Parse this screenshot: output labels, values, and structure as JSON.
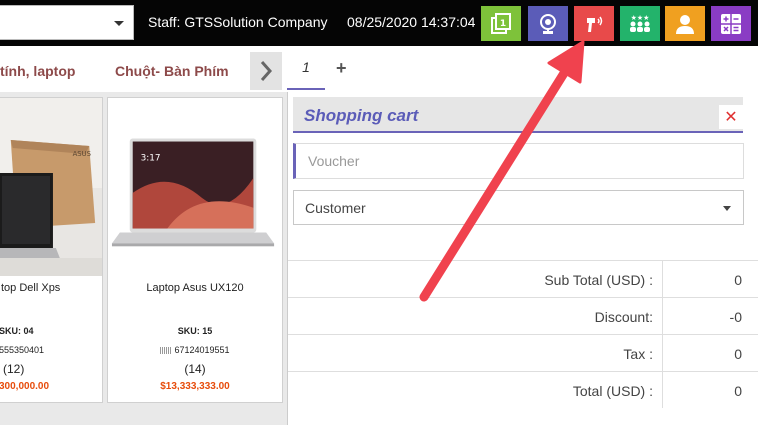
{
  "topbar": {
    "staff": "Staff: GTSSolution Company",
    "datetime": "08/25/2020 14:37:04",
    "buttons": [
      {
        "icon": "display-icon",
        "color": "#7ec23a"
      },
      {
        "icon": "webcam-icon",
        "color": "#5b5cb8"
      },
      {
        "icon": "barcode-scanner-icon",
        "color": "#e84a4a"
      },
      {
        "icon": "rating-users-icon",
        "color": "#23b36b"
      },
      {
        "icon": "user-icon",
        "color": "#f0a020"
      },
      {
        "icon": "calculator-icon",
        "color": "#8a3cc4"
      }
    ]
  },
  "categories": [
    {
      "label": "tính, laptop"
    },
    {
      "label": "Chuột- Bàn Phím"
    }
  ],
  "orders": {
    "tabs": [
      {
        "label": "1"
      }
    ],
    "add_label": "+"
  },
  "products": [
    {
      "name": "top Dell Xps",
      "sku": "SKU: 04",
      "barcode": "555350401",
      "stock": "(12)",
      "price": "300,000.00"
    },
    {
      "name": "Laptop Asus UX120",
      "sku": "SKU: 15",
      "barcode": "67124019551",
      "stock": "(14)",
      "price": "$13,333,333.00"
    }
  ],
  "cart": {
    "title": "Shopping cart",
    "close": "✕",
    "voucher_placeholder": "Voucher",
    "customer_label": "Customer",
    "summary": [
      {
        "label": "Sub Total (USD) :",
        "value": "0"
      },
      {
        "label": "Discount:",
        "value": "-0"
      },
      {
        "label": "Tax :",
        "value": "0"
      },
      {
        "label": "Total (USD) :",
        "value": "0"
      }
    ]
  },
  "colors": {
    "accent": "#6a63b8",
    "category_text": "#8d4a4a",
    "price": "#e74c0c",
    "annotation_arrow": "#f0424e"
  }
}
